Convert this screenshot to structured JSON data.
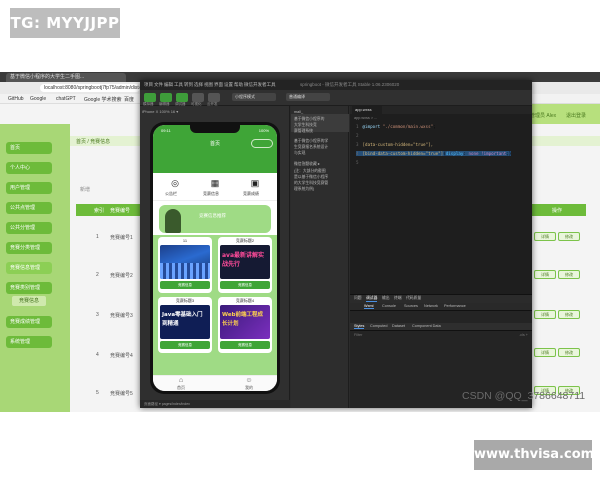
{
  "watermarks": {
    "top": "TG: MYYJJPP",
    "bottom": "www.thvisa.com",
    "csdn": "CSDN @QQ_3786648711"
  },
  "browser": {
    "tab_title": "基于微信小程序的大学生二手图...",
    "address": "localhost:8080/springbootj7fp75/admin/dist/index.html",
    "bookmarks": [
      "GitHub",
      "Google",
      "chatGPT",
      "Google 学术搜索",
      "百度"
    ]
  },
  "admin": {
    "header_right": [
      "管理员 Alex",
      "退出登录"
    ],
    "breadcrumb": "首页 / 竞赛信息",
    "add_label": "新增",
    "sidebar": [
      "首页",
      "个人中心",
      "用户管理",
      "公共点管理",
      "公共分管理",
      "竞赛分类管理",
      "竞赛信息管理",
      "竞赛类别管理",
      "竞赛成绩管理",
      "系统管理"
    ],
    "sidebar_sub": "竞赛信息",
    "table_head_left": [
      "索引",
      "竞赛编号"
    ],
    "table_head_right": "操作",
    "rows": [
      {
        "index": "1",
        "code": "竞赛编号1"
      },
      {
        "index": "2",
        "code": "竞赛编号2"
      },
      {
        "index": "3",
        "code": "竞赛编号3"
      },
      {
        "index": "4",
        "code": "竞赛编号4"
      },
      {
        "index": "5",
        "code": "竞赛编号5"
      }
    ],
    "row_buttons": [
      "详情",
      "修改"
    ]
  },
  "devtools": {
    "menu": [
      "项目",
      "文件",
      "编辑",
      "工具",
      "转到",
      "选择",
      "视图",
      "界面",
      "设置",
      "帮助",
      "微信开发者工具"
    ],
    "title": "springboot - 微信开发者工具 Stable 1.06.2306020",
    "toolbar_labels": [
      "模拟器",
      "编辑器",
      "调试器",
      "可视化",
      "云开发"
    ],
    "compile_mode": "小程序模式",
    "compile_target": "普通编译",
    "sim_device": "iPhone X 100% 16 ▾",
    "sim_footer": "页面路径 ▾  pages/index/index",
    "tree": [
      "mall_",
      "基于微信小程序的",
      "大学生科技竞",
      "赛管理系统",
      "基于微信小程序的学",
      "生竞赛报名系统设计",
      "与实现",
      "微信答题收藏 ▸",
      "(注：大部分的截图",
      "是以基于微信小程序",
      "的大学生科技竞赛管",
      "理系统为例)"
    ],
    "editor_tab": "app.wxss",
    "editor_crumb": "app.wxss > ...",
    "code_lines": [
      {
        "n": "1",
        "parts": [
          {
            "c": "c-attr",
            "t": "@import "
          },
          {
            "c": "c-str",
            "t": "\"./common/main.wxss\""
          },
          {
            "c": "",
            "t": ";"
          }
        ]
      },
      {
        "n": "2",
        "parts": [
          {
            "c": "",
            "t": ""
          }
        ]
      },
      {
        "n": "3",
        "parts": [
          {
            "c": "c-sel",
            "t": "[data-custom-hidden=\"true\"],"
          }
        ]
      },
      {
        "n": "4",
        "parts": [
          {
            "c": "c-sel",
            "t": "[bind-data-custom-hidden=\"true\"]"
          },
          {
            "c": "",
            "t": "{"
          },
          {
            "c": "c-prop",
            "t": "display"
          },
          {
            "c": "",
            "t": ": "
          },
          {
            "c": "c-kw",
            "t": "none !important"
          },
          {
            "c": "",
            "t": ";}"
          }
        ]
      },
      {
        "n": "5",
        "parts": [
          {
            "c": "",
            "t": ""
          }
        ]
      }
    ],
    "debug_tabs1": [
      "问题",
      "调试器",
      "输出",
      "终端",
      "代码质量"
    ],
    "debug_tabs2": [
      "Wxml",
      "Console",
      "Sources",
      "Network",
      "Performance"
    ],
    "debug_tabs3": [
      "Styles",
      "Computed",
      "Dataset",
      "Component Data"
    ],
    "filter": "Filter",
    "cls": ".cls  +"
  },
  "phone": {
    "status_time": "09:11",
    "status_right": "100%",
    "nav_title": "首页",
    "icons": [
      {
        "icon": "compass-icon",
        "glyph": "◎",
        "label": "公告栏"
      },
      {
        "icon": "grid-icon",
        "glyph": "▦",
        "label": "竞赛信息"
      },
      {
        "icon": "wallet-icon",
        "glyph": "▣",
        "label": "竞赛成绩"
      }
    ],
    "recommend_title": "竞赛信息推荐",
    "tiles": [
      {
        "title": "11",
        "btn": "竞赛信息"
      },
      {
        "title": "竞赛标题2",
        "btn": "竞赛信息"
      },
      {
        "title": "竞赛标题3",
        "btn": "竞赛信息"
      },
      {
        "title": "竞赛标题4",
        "btn": "竞赛信息"
      }
    ],
    "tile_img_texts": [
      "",
      "ava最新讲解实战先行",
      "Java零基础入门到精通",
      "Web前端工程成长计划"
    ],
    "tabbar": [
      {
        "icon": "home-icon",
        "glyph": "⌂",
        "label": "首页"
      },
      {
        "icon": "user-icon",
        "glyph": "☺",
        "label": "我的"
      }
    ]
  }
}
